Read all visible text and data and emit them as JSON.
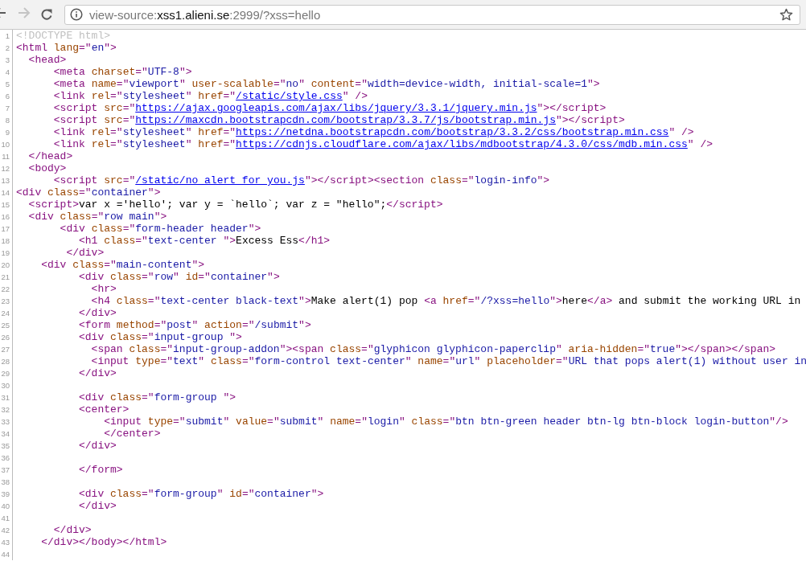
{
  "toolbar": {
    "back": {
      "disabled": false
    },
    "forward": {
      "disabled": true
    },
    "address": [
      {
        "text": "view-source:",
        "emphasized": false
      },
      {
        "text": "xss1.alieni.se",
        "emphasized": true
      },
      {
        "text": ":2999/?xss=hello",
        "emphasized": false
      }
    ],
    "bookmarked": false
  },
  "source_lines": [
    {
      "number": "1",
      "segments": [
        {
          "kind": "doctype",
          "text": "<!DOCTYPE html>"
        }
      ]
    },
    {
      "number": "2",
      "segments": [
        {
          "kind": "tag",
          "text": "<html"
        },
        {
          "kind": "attr",
          "text": " lang"
        },
        {
          "kind": "tag",
          "text": "=\""
        },
        {
          "kind": "value",
          "text": "en"
        },
        {
          "kind": "tag",
          "text": "\">"
        }
      ]
    },
    {
      "number": "3",
      "segments": [
        {
          "kind": "tag",
          "text": "  <head>"
        }
      ]
    },
    {
      "number": "4",
      "segments": [
        {
          "kind": "tag",
          "text": "      <meta"
        },
        {
          "kind": "attr",
          "text": " charset"
        },
        {
          "kind": "tag",
          "text": "=\""
        },
        {
          "kind": "value",
          "text": "UTF-8"
        },
        {
          "kind": "tag",
          "text": "\">"
        }
      ]
    },
    {
      "number": "5",
      "segments": [
        {
          "kind": "tag",
          "text": "      <meta"
        },
        {
          "kind": "attr",
          "text": " name"
        },
        {
          "kind": "tag",
          "text": "=\""
        },
        {
          "kind": "value",
          "text": "viewport"
        },
        {
          "kind": "tag",
          "text": "\""
        },
        {
          "kind": "attr",
          "text": " user-scalable"
        },
        {
          "kind": "tag",
          "text": "=\""
        },
        {
          "kind": "value",
          "text": "no"
        },
        {
          "kind": "tag",
          "text": "\""
        },
        {
          "kind": "attr",
          "text": " content"
        },
        {
          "kind": "tag",
          "text": "=\""
        },
        {
          "kind": "value",
          "text": "width=device-width, initial-scale=1"
        },
        {
          "kind": "tag",
          "text": "\">"
        }
      ]
    },
    {
      "number": "6",
      "segments": [
        {
          "kind": "tag",
          "text": "      <link"
        },
        {
          "kind": "attr",
          "text": " rel"
        },
        {
          "kind": "tag",
          "text": "=\""
        },
        {
          "kind": "value",
          "text": "stylesheet"
        },
        {
          "kind": "tag",
          "text": "\""
        },
        {
          "kind": "attr",
          "text": " href"
        },
        {
          "kind": "tag",
          "text": "=\""
        },
        {
          "kind": "link",
          "text": "/static/style.css"
        },
        {
          "kind": "tag",
          "text": "\" />"
        }
      ]
    },
    {
      "number": "7",
      "segments": [
        {
          "kind": "tag",
          "text": "      <script"
        },
        {
          "kind": "attr",
          "text": " src"
        },
        {
          "kind": "tag",
          "text": "=\""
        },
        {
          "kind": "link",
          "text": "https://ajax.googleapis.com/ajax/libs/jquery/3.3.1/jquery.min.js"
        },
        {
          "kind": "tag",
          "text": "\"></script>"
        }
      ]
    },
    {
      "number": "8",
      "segments": [
        {
          "kind": "tag",
          "text": "      <script"
        },
        {
          "kind": "attr",
          "text": " src"
        },
        {
          "kind": "tag",
          "text": "=\""
        },
        {
          "kind": "link",
          "text": "https://maxcdn.bootstrapcdn.com/bootstrap/3.3.7/js/bootstrap.min.js"
        },
        {
          "kind": "tag",
          "text": "\"></script>"
        }
      ]
    },
    {
      "number": "9",
      "segments": [
        {
          "kind": "tag",
          "text": "      <link"
        },
        {
          "kind": "attr",
          "text": " rel"
        },
        {
          "kind": "tag",
          "text": "=\""
        },
        {
          "kind": "value",
          "text": "stylesheet"
        },
        {
          "kind": "tag",
          "text": "\""
        },
        {
          "kind": "attr",
          "text": " href"
        },
        {
          "kind": "tag",
          "text": "=\""
        },
        {
          "kind": "link",
          "text": "https://netdna.bootstrapcdn.com/bootstrap/3.3.2/css/bootstrap.min.css"
        },
        {
          "kind": "tag",
          "text": "\" />"
        }
      ]
    },
    {
      "number": "10",
      "segments": [
        {
          "kind": "tag",
          "text": "      <link"
        },
        {
          "kind": "attr",
          "text": " rel"
        },
        {
          "kind": "tag",
          "text": "=\""
        },
        {
          "kind": "value",
          "text": "stylesheet"
        },
        {
          "kind": "tag",
          "text": "\""
        },
        {
          "kind": "attr",
          "text": " href"
        },
        {
          "kind": "tag",
          "text": "=\""
        },
        {
          "kind": "link",
          "text": "https://cdnjs.cloudflare.com/ajax/libs/mdbootstrap/4.3.0/css/mdb.min.css"
        },
        {
          "kind": "tag",
          "text": "\" />"
        }
      ]
    },
    {
      "number": "11",
      "segments": [
        {
          "kind": "tag",
          "text": "  </head>"
        }
      ]
    },
    {
      "number": "12",
      "segments": [
        {
          "kind": "tag",
          "text": "  <body>"
        }
      ]
    },
    {
      "number": "13",
      "segments": [
        {
          "kind": "tag",
          "text": "      <script"
        },
        {
          "kind": "attr",
          "text": " src"
        },
        {
          "kind": "tag",
          "text": "=\""
        },
        {
          "kind": "link",
          "text": "/static/no_alert_for_you.js"
        },
        {
          "kind": "tag",
          "text": "\"></script><section"
        },
        {
          "kind": "attr",
          "text": " class"
        },
        {
          "kind": "tag",
          "text": "=\""
        },
        {
          "kind": "value",
          "text": "login-info"
        },
        {
          "kind": "tag",
          "text": "\">"
        }
      ]
    },
    {
      "number": "14",
      "segments": [
        {
          "kind": "tag",
          "text": "<div"
        },
        {
          "kind": "attr",
          "text": " class"
        },
        {
          "kind": "tag",
          "text": "=\""
        },
        {
          "kind": "value",
          "text": "container"
        },
        {
          "kind": "tag",
          "text": "\">"
        }
      ]
    },
    {
      "number": "15",
      "segments": [
        {
          "kind": "tag",
          "text": "  <script>"
        },
        {
          "kind": "text",
          "text": "var x ='hello'; var y = `hello`; var z = \"hello\";"
        },
        {
          "kind": "tag",
          "text": "</script>"
        }
      ]
    },
    {
      "number": "16",
      "segments": [
        {
          "kind": "tag",
          "text": "  <div"
        },
        {
          "kind": "attr",
          "text": " class"
        },
        {
          "kind": "tag",
          "text": "=\""
        },
        {
          "kind": "value",
          "text": "row main"
        },
        {
          "kind": "tag",
          "text": "\">"
        }
      ]
    },
    {
      "number": "17",
      "segments": [
        {
          "kind": "tag",
          "text": "       <div"
        },
        {
          "kind": "attr",
          "text": " class"
        },
        {
          "kind": "tag",
          "text": "=\""
        },
        {
          "kind": "value",
          "text": "form-header header"
        },
        {
          "kind": "tag",
          "text": "\">"
        }
      ]
    },
    {
      "number": "18",
      "segments": [
        {
          "kind": "tag",
          "text": "          <h1"
        },
        {
          "kind": "attr",
          "text": " class"
        },
        {
          "kind": "tag",
          "text": "=\""
        },
        {
          "kind": "value",
          "text": "text-center "
        },
        {
          "kind": "tag",
          "text": "\">"
        },
        {
          "kind": "text",
          "text": "Excess Ess"
        },
        {
          "kind": "tag",
          "text": "</h1>"
        }
      ]
    },
    {
      "number": "19",
      "segments": [
        {
          "kind": "tag",
          "text": "        </div>"
        }
      ]
    },
    {
      "number": "20",
      "segments": [
        {
          "kind": "tag",
          "text": "    <div"
        },
        {
          "kind": "attr",
          "text": " class"
        },
        {
          "kind": "tag",
          "text": "=\""
        },
        {
          "kind": "value",
          "text": "main-content"
        },
        {
          "kind": "tag",
          "text": "\">"
        }
      ]
    },
    {
      "number": "21",
      "segments": [
        {
          "kind": "tag",
          "text": "          <div"
        },
        {
          "kind": "attr",
          "text": " class"
        },
        {
          "kind": "tag",
          "text": "=\""
        },
        {
          "kind": "value",
          "text": "row"
        },
        {
          "kind": "tag",
          "text": "\""
        },
        {
          "kind": "attr",
          "text": " id"
        },
        {
          "kind": "tag",
          "text": "=\""
        },
        {
          "kind": "value",
          "text": "container"
        },
        {
          "kind": "tag",
          "text": "\">"
        }
      ]
    },
    {
      "number": "22",
      "segments": [
        {
          "kind": "tag",
          "text": "            <hr>"
        }
      ]
    },
    {
      "number": "23",
      "segments": [
        {
          "kind": "tag",
          "text": "            <h4"
        },
        {
          "kind": "attr",
          "text": " class"
        },
        {
          "kind": "tag",
          "text": "=\""
        },
        {
          "kind": "value",
          "text": "text-center black-text"
        },
        {
          "kind": "tag",
          "text": "\">"
        },
        {
          "kind": "text",
          "text": "Make alert(1) pop "
        },
        {
          "kind": "tag",
          "text": "<a"
        },
        {
          "kind": "attr",
          "text": " href"
        },
        {
          "kind": "tag",
          "text": "=\""
        },
        {
          "kind": "value",
          "text": "/?xss=hello"
        },
        {
          "kind": "tag",
          "text": "\">"
        },
        {
          "kind": "text",
          "text": "here"
        },
        {
          "kind": "tag",
          "text": "</a>"
        },
        {
          "kind": "text",
          "text": " and submit the working URL in"
        }
      ]
    },
    {
      "number": "24",
      "segments": [
        {
          "kind": "tag",
          "text": "          </div>"
        }
      ]
    },
    {
      "number": "25",
      "segments": [
        {
          "kind": "tag",
          "text": "          <form"
        },
        {
          "kind": "attr",
          "text": " method"
        },
        {
          "kind": "tag",
          "text": "=\""
        },
        {
          "kind": "value",
          "text": "post"
        },
        {
          "kind": "tag",
          "text": "\""
        },
        {
          "kind": "attr",
          "text": " action"
        },
        {
          "kind": "tag",
          "text": "=\""
        },
        {
          "kind": "value",
          "text": "/submit"
        },
        {
          "kind": "tag",
          "text": "\">"
        }
      ]
    },
    {
      "number": "26",
      "segments": [
        {
          "kind": "tag",
          "text": "          <div"
        },
        {
          "kind": "attr",
          "text": " class"
        },
        {
          "kind": "tag",
          "text": "=\""
        },
        {
          "kind": "value",
          "text": "input-group "
        },
        {
          "kind": "tag",
          "text": "\">"
        }
      ]
    },
    {
      "number": "27",
      "segments": [
        {
          "kind": "tag",
          "text": "            <span"
        },
        {
          "kind": "attr",
          "text": " class"
        },
        {
          "kind": "tag",
          "text": "=\""
        },
        {
          "kind": "value",
          "text": "input-group-addon"
        },
        {
          "kind": "tag",
          "text": "\"><span"
        },
        {
          "kind": "attr",
          "text": " class"
        },
        {
          "kind": "tag",
          "text": "=\""
        },
        {
          "kind": "value",
          "text": "glyphicon glyphicon-paperclip"
        },
        {
          "kind": "tag",
          "text": "\""
        },
        {
          "kind": "attr",
          "text": " aria-hidden"
        },
        {
          "kind": "tag",
          "text": "=\""
        },
        {
          "kind": "value",
          "text": "true"
        },
        {
          "kind": "tag",
          "text": "\"></span></span>"
        }
      ]
    },
    {
      "number": "28",
      "segments": [
        {
          "kind": "tag",
          "text": "            <input"
        },
        {
          "kind": "attr",
          "text": " type"
        },
        {
          "kind": "tag",
          "text": "=\""
        },
        {
          "kind": "value",
          "text": "text"
        },
        {
          "kind": "tag",
          "text": "\""
        },
        {
          "kind": "attr",
          "text": " class"
        },
        {
          "kind": "tag",
          "text": "=\""
        },
        {
          "kind": "value",
          "text": "form-control text-center"
        },
        {
          "kind": "tag",
          "text": "\""
        },
        {
          "kind": "attr",
          "text": " name"
        },
        {
          "kind": "tag",
          "text": "=\""
        },
        {
          "kind": "value",
          "text": "url"
        },
        {
          "kind": "tag",
          "text": "\""
        },
        {
          "kind": "attr",
          "text": " placeholder"
        },
        {
          "kind": "tag",
          "text": "=\""
        },
        {
          "kind": "value",
          "text": "URL that pops alert(1) without user in"
        }
      ]
    },
    {
      "number": "29",
      "segments": [
        {
          "kind": "tag",
          "text": "          </div>"
        }
      ]
    },
    {
      "number": "30"
    },
    {
      "number": "31",
      "segments": [
        {
          "kind": "tag",
          "text": "          <div"
        },
        {
          "kind": "attr",
          "text": " class"
        },
        {
          "kind": "tag",
          "text": "=\""
        },
        {
          "kind": "value",
          "text": "form-group "
        },
        {
          "kind": "tag",
          "text": "\">"
        }
      ]
    },
    {
      "number": "32",
      "segments": [
        {
          "kind": "tag",
          "text": "          <center>"
        }
      ]
    },
    {
      "number": "33",
      "segments": [
        {
          "kind": "tag",
          "text": "              <input"
        },
        {
          "kind": "attr",
          "text": " type"
        },
        {
          "kind": "tag",
          "text": "=\""
        },
        {
          "kind": "value",
          "text": "submit"
        },
        {
          "kind": "tag",
          "text": "\""
        },
        {
          "kind": "attr",
          "text": " value"
        },
        {
          "kind": "tag",
          "text": "=\""
        },
        {
          "kind": "value",
          "text": "submit"
        },
        {
          "kind": "tag",
          "text": "\""
        },
        {
          "kind": "attr",
          "text": " name"
        },
        {
          "kind": "tag",
          "text": "=\""
        },
        {
          "kind": "value",
          "text": "login"
        },
        {
          "kind": "tag",
          "text": "\""
        },
        {
          "kind": "attr",
          "text": " class"
        },
        {
          "kind": "tag",
          "text": "=\""
        },
        {
          "kind": "value",
          "text": "btn btn-green header btn-lg btn-block login-button"
        },
        {
          "kind": "tag",
          "text": "\"/>"
        }
      ]
    },
    {
      "number": "34",
      "segments": [
        {
          "kind": "tag",
          "text": "              </center>"
        }
      ]
    },
    {
      "number": "35",
      "segments": [
        {
          "kind": "tag",
          "text": "          </div>"
        }
      ]
    },
    {
      "number": "36"
    },
    {
      "number": "37",
      "segments": [
        {
          "kind": "tag",
          "text": "          </form>"
        }
      ]
    },
    {
      "number": "38"
    },
    {
      "number": "39",
      "segments": [
        {
          "kind": "tag",
          "text": "          <div"
        },
        {
          "kind": "attr",
          "text": " class"
        },
        {
          "kind": "tag",
          "text": "=\""
        },
        {
          "kind": "value",
          "text": "form-group"
        },
        {
          "kind": "tag",
          "text": "\""
        },
        {
          "kind": "attr",
          "text": " id"
        },
        {
          "kind": "tag",
          "text": "=\""
        },
        {
          "kind": "value",
          "text": "container"
        },
        {
          "kind": "tag",
          "text": "\">"
        }
      ]
    },
    {
      "number": "40",
      "segments": [
        {
          "kind": "tag",
          "text": "          </div>"
        }
      ]
    },
    {
      "number": "41"
    },
    {
      "number": "42",
      "segments": [
        {
          "kind": "tag",
          "text": "      </div>"
        }
      ]
    },
    {
      "number": "43",
      "segments": [
        {
          "kind": "tag",
          "text": "    </div></body></html>"
        }
      ]
    },
    {
      "number": "44"
    }
  ]
}
